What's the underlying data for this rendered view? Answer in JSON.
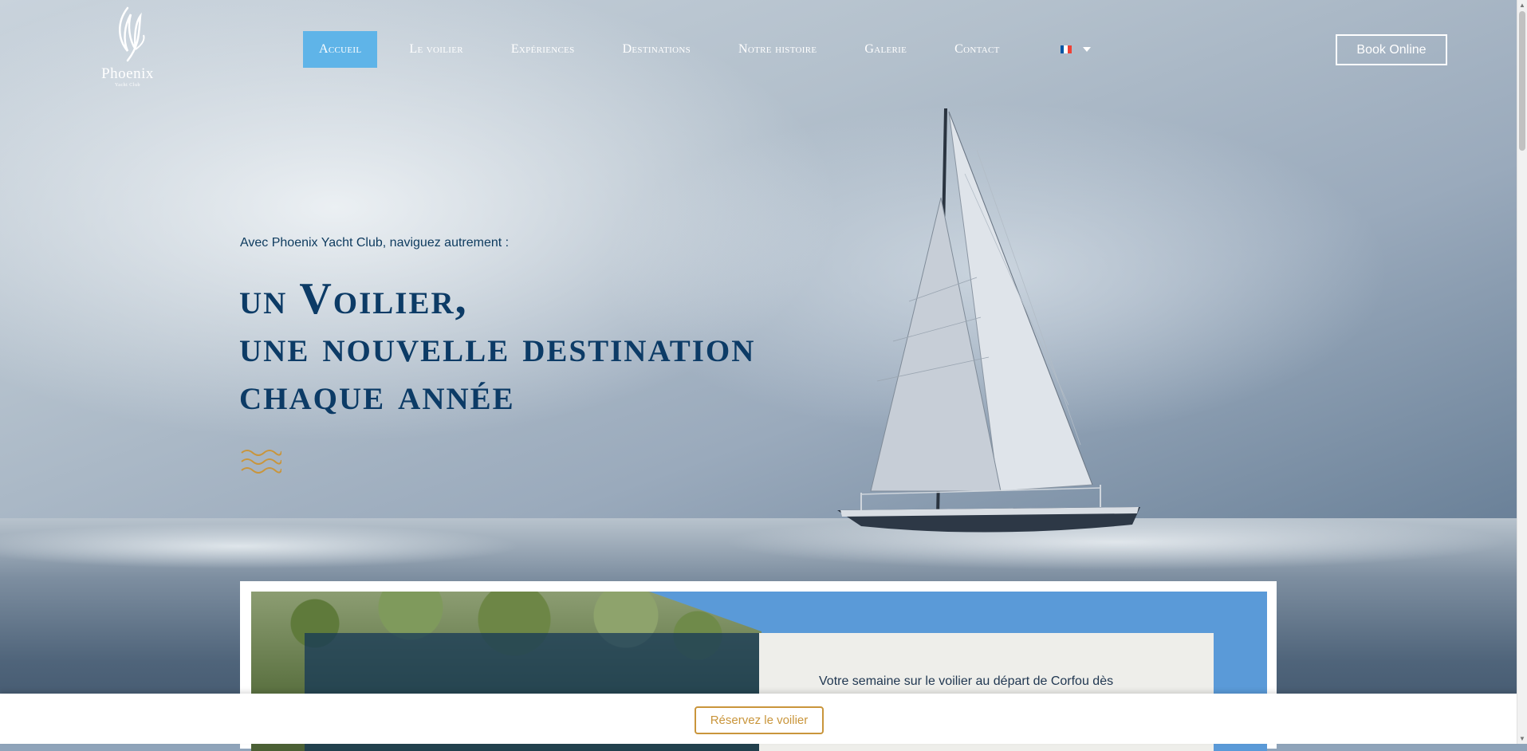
{
  "header": {
    "logo": {
      "brand": "Phoenix",
      "sub": "Yacht Club"
    },
    "nav": [
      {
        "label": "Accueil",
        "active": true
      },
      {
        "label": "Le voilier",
        "active": false
      },
      {
        "label": "Expériences",
        "active": false
      },
      {
        "label": "Destinations",
        "active": false
      },
      {
        "label": "Notre histoire",
        "active": false
      },
      {
        "label": "Galerie",
        "active": false
      },
      {
        "label": "Contact",
        "active": false
      }
    ],
    "language": {
      "flag": "fr-flag-icon",
      "flag_colors": [
        "#0055a4",
        "#ffffff",
        "#ef4135"
      ]
    },
    "book_button": "Book Online"
  },
  "hero": {
    "intro": "Avec Phoenix Yacht Club, naviguez autrement :",
    "headline": [
      "un Voilier,",
      "une nouvelle destination",
      "chaque année"
    ],
    "divider_icon": "waves-icon"
  },
  "section": {
    "text": "Votre semaine sur le voilier au départ de Corfou dès"
  },
  "sticky_bar": {
    "reserve_button": "Réservez le voilier"
  },
  "colors": {
    "nav_active": "#5fb4e8",
    "headline": "#0c3b66",
    "accent_gold": "#c9953b"
  }
}
